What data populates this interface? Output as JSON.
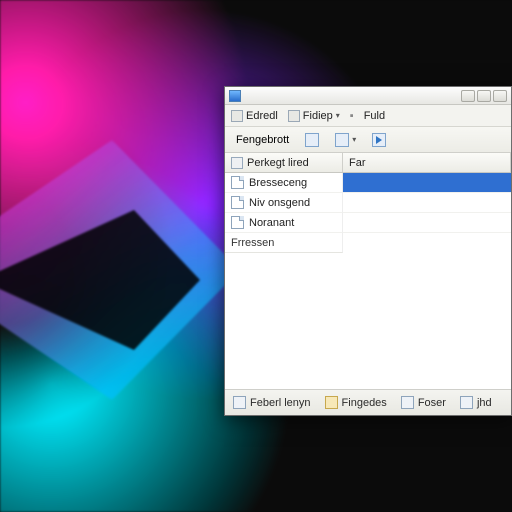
{
  "menubar": {
    "items": [
      {
        "label": "Edredl"
      },
      {
        "label": "Fidiep"
      },
      {
        "label": "Fuld"
      }
    ]
  },
  "toolbar": {
    "label": "Fengebrott"
  },
  "columns": {
    "left": "Perkegt lired",
    "right": "Far"
  },
  "rows": [
    {
      "name": "Bresseceng"
    },
    {
      "name": "Niv onsgend"
    },
    {
      "name": "Noranant"
    },
    {
      "name": "Frressen"
    }
  ],
  "status": {
    "left": "Feberl lenyn",
    "mid1": "Fingedes",
    "mid2": "Foser",
    "right": "jhd"
  }
}
